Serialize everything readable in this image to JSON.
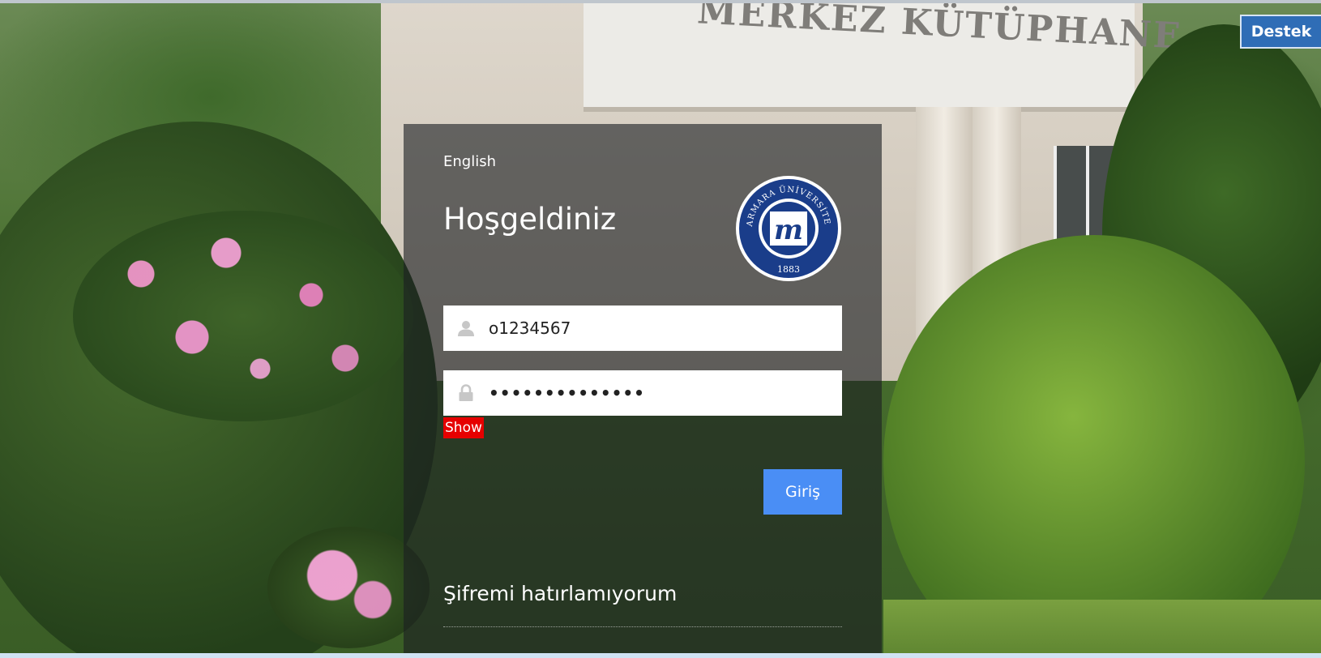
{
  "background": {
    "sign_text": "MERKEZ KÜTÜPHANE"
  },
  "login": {
    "language_link": "English",
    "welcome": "Hoşgeldiniz",
    "logo": {
      "arc_text": "MARMARA ÜNİVERSİTESİ",
      "year": "1883",
      "mark": "m",
      "color": "#1a3d8a"
    },
    "username": {
      "value": "o1234567",
      "icon": "user-icon"
    },
    "password": {
      "value": "••••••••••••••",
      "icon": "lock-icon"
    },
    "show_label": "Show",
    "submit_label": "Giriş",
    "forgot_label": "Şifremi hatırlamıyorum"
  },
  "support_label": "Destek",
  "colors": {
    "submit": "#4a8ef5",
    "show": "#e60000",
    "support": "#2f6db6",
    "panel": "rgba(28,30,34,0.62)"
  }
}
